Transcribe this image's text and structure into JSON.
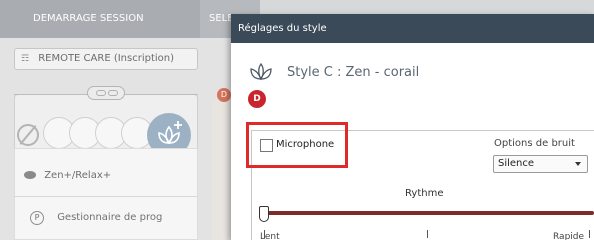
{
  "background": {
    "tabs": [
      {
        "label": "DEMARRAGE SESSION"
      },
      {
        "label": "SELECTIO"
      }
    ],
    "patient_field": "REMOTE CARE (Inscription)",
    "marker_letter": "D",
    "list_items": [
      {
        "label": "Zen+/Relax+",
        "icon": "eye-icon"
      },
      {
        "label": "Gestionnaire de prog",
        "icon": "p-circle-icon"
      }
    ]
  },
  "dialog": {
    "title": "Réglages du style",
    "style_name": "Style C : Zen - corail",
    "badge": "D",
    "microphone_label": "Microphone",
    "microphone_checked": false,
    "noise_label": "Options de bruit",
    "noise_value": "Silence",
    "rhythm_label": "Rythme",
    "rhythm_min": "Lent",
    "rhythm_max": "Rapide",
    "rhythm_level": 0
  },
  "colors": {
    "title_bar": "#3b4a58",
    "highlight": "#e02a2a",
    "badge": "#c9252c",
    "slider_track": "#7d2a2a"
  }
}
